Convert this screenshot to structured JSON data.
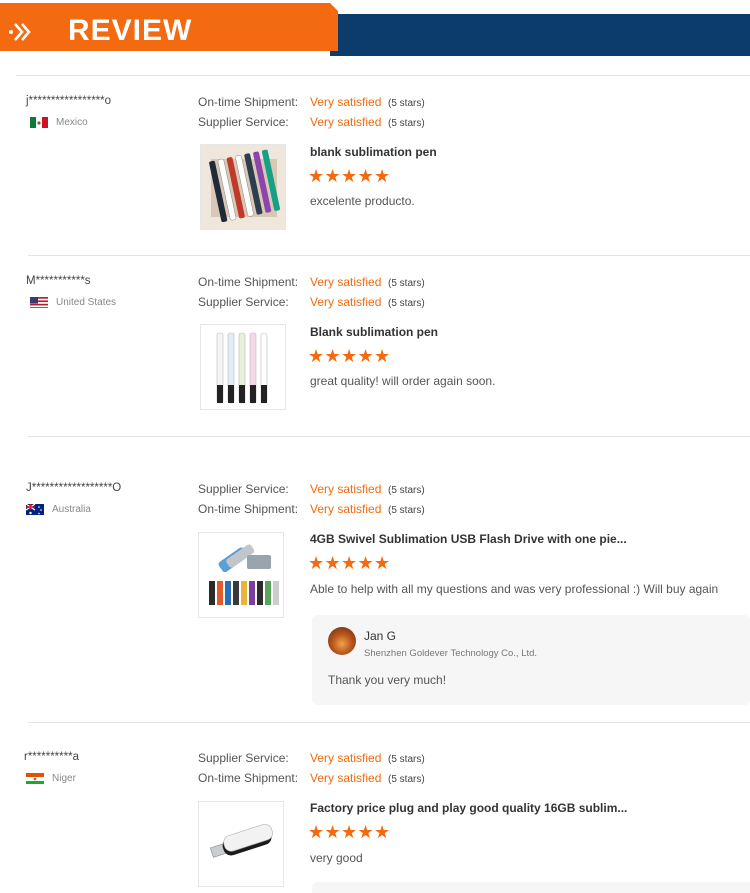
{
  "header": {
    "title": "REVIEW",
    "icon": "double-chevron-icon",
    "colors": {
      "orange": "#f36a10",
      "navy": "#0c3c6b"
    }
  },
  "reviews": [
    {
      "reviewer": "j*****************o",
      "country": "Mexico",
      "flag_icon": "mexico-flag-icon",
      "ratings": [
        {
          "label": "On-time Shipment:",
          "value": "Very satisfied",
          "stars": "(5 stars)"
        },
        {
          "label": "Supplier Service:",
          "value": "Very satisfied",
          "stars": "(5 stars)"
        }
      ],
      "product_title": "blank sublimation pen",
      "star_count": 5,
      "comment": "excelente producto."
    },
    {
      "reviewer": "M***********s",
      "country": "United States",
      "flag_icon": "usa-flag-icon",
      "ratings": [
        {
          "label": "On-time Shipment:",
          "value": "Very satisfied",
          "stars": "(5 stars)"
        },
        {
          "label": "Supplier Service:",
          "value": "Very satisfied",
          "stars": "(5 stars)"
        }
      ],
      "product_title": "Blank sublimation pen",
      "star_count": 5,
      "comment": "great quality! will order again soon."
    },
    {
      "reviewer": "J******************O",
      "country": "Australia",
      "flag_icon": "australia-flag-icon",
      "ratings": [
        {
          "label": "Supplier Service:",
          "value": "Very satisfied",
          "stars": "(5 stars)"
        },
        {
          "label": "On-time Shipment:",
          "value": "Very satisfied",
          "stars": "(5 stars)"
        }
      ],
      "product_title": "4GB Swivel Sublimation USB Flash Drive with one pie...",
      "star_count": 5,
      "comment": "Able to help with all my questions and was very professional :) Will buy again",
      "reply": {
        "name": "Jan G",
        "company": "Shenzhen Goldever Technology Co., Ltd.",
        "text": "Thank you very much!"
      }
    },
    {
      "reviewer": "r**********a",
      "country": "Niger",
      "flag_icon": "niger-flag-icon",
      "ratings": [
        {
          "label": "Supplier Service:",
          "value": "Very satisfied",
          "stars": "(5 stars)"
        },
        {
          "label": "On-time Shipment:",
          "value": "Very satisfied",
          "stars": "(5 stars)"
        }
      ],
      "product_title": "Factory price plug and play good quality 16GB sublim...",
      "star_count": 5,
      "comment": "very good"
    }
  ]
}
